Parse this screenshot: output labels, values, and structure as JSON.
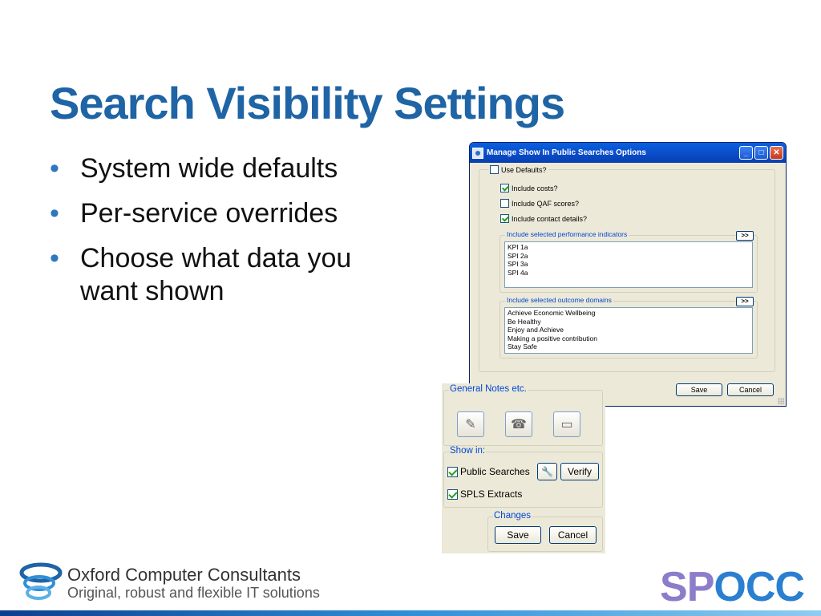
{
  "slide": {
    "title": "Search Visibility Settings",
    "bullets": [
      "System wide defaults",
      "Per-service overrides",
      "Choose what data you want shown"
    ]
  },
  "dialog": {
    "title": "Manage Show In Public Searches Options",
    "use_defaults": {
      "label": "Use Defaults?",
      "checked": false
    },
    "options": [
      {
        "label": "Include costs?",
        "checked": true
      },
      {
        "label": "Include QAF scores?",
        "checked": false
      },
      {
        "label": "Include contact details?",
        "checked": true
      }
    ],
    "kpi_group": {
      "label": "Include selected performance indicators",
      "more": ">>",
      "items": [
        "KPI 1a",
        "SPI 2a",
        "SPI 3a",
        "SPI 4a"
      ]
    },
    "outcome_group": {
      "label": "Include selected outcome domains",
      "more": ">>",
      "items": [
        "Achieve Economic Wellbeing",
        "Be Healthy",
        "Enjoy and Achieve",
        "Making a positive contribution",
        "Stay Safe"
      ]
    },
    "save_label": "Save",
    "cancel_label": "Cancel"
  },
  "panel": {
    "notes_group": "General Notes etc.",
    "show_in_group": "Show in:",
    "public_searches": {
      "label": "Public Searches",
      "checked": true
    },
    "verify_label": "Verify",
    "spls_extracts": {
      "label": "SPLS Extracts",
      "checked": true
    },
    "changes_group": "Changes",
    "save_label": "Save",
    "cancel_label": "Cancel"
  },
  "footer": {
    "company": "Oxford Computer Consultants",
    "tagline": "Original, robust and flexible IT solutions",
    "product_logo": "SPOCC",
    "colors": {
      "title_blue": "#1f64a5",
      "spocc_purple": "#8c7cc9",
      "spocc_blue": "#2a7fd0"
    }
  }
}
